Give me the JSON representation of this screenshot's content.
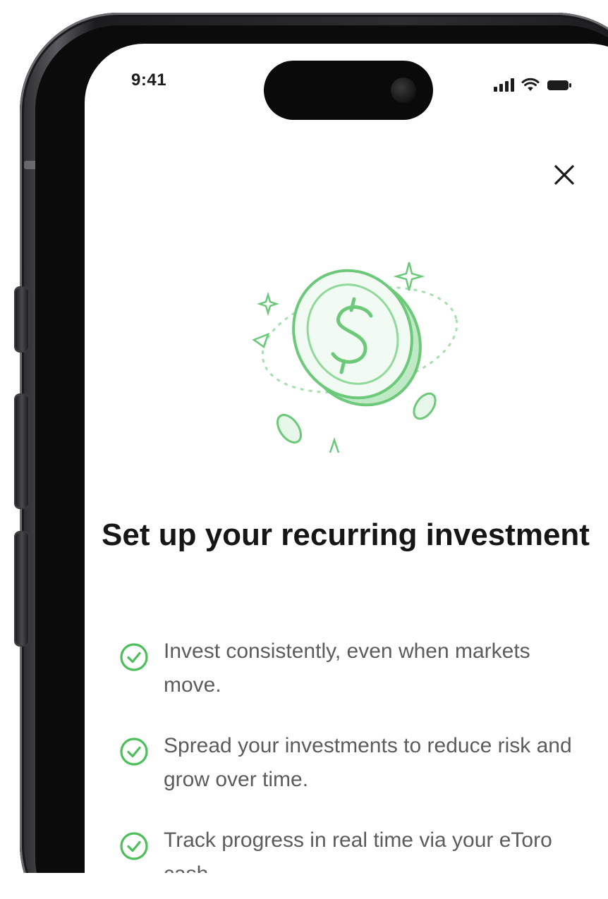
{
  "status_bar": {
    "time": "9:41"
  },
  "modal": {
    "close_icon": "close-icon",
    "illustration_icon": "dollar-coin-illustration",
    "title": "Set up your recurring investment",
    "benefits": [
      {
        "icon": "check-circle-icon",
        "text": "Invest consistently, even when markets move."
      },
      {
        "icon": "check-circle-icon",
        "text": "Spread your investments to reduce risk and grow over time."
      },
      {
        "icon": "check-circle-icon",
        "text": "Track progress in real time via your eToro cash."
      }
    ]
  },
  "colors": {
    "accent_green": "#4cbf5a",
    "illustration_green": "#8fd99a",
    "title_text": "#161616",
    "body_text": "#5c5c5c",
    "phone_frame": "#2a2a2c"
  }
}
